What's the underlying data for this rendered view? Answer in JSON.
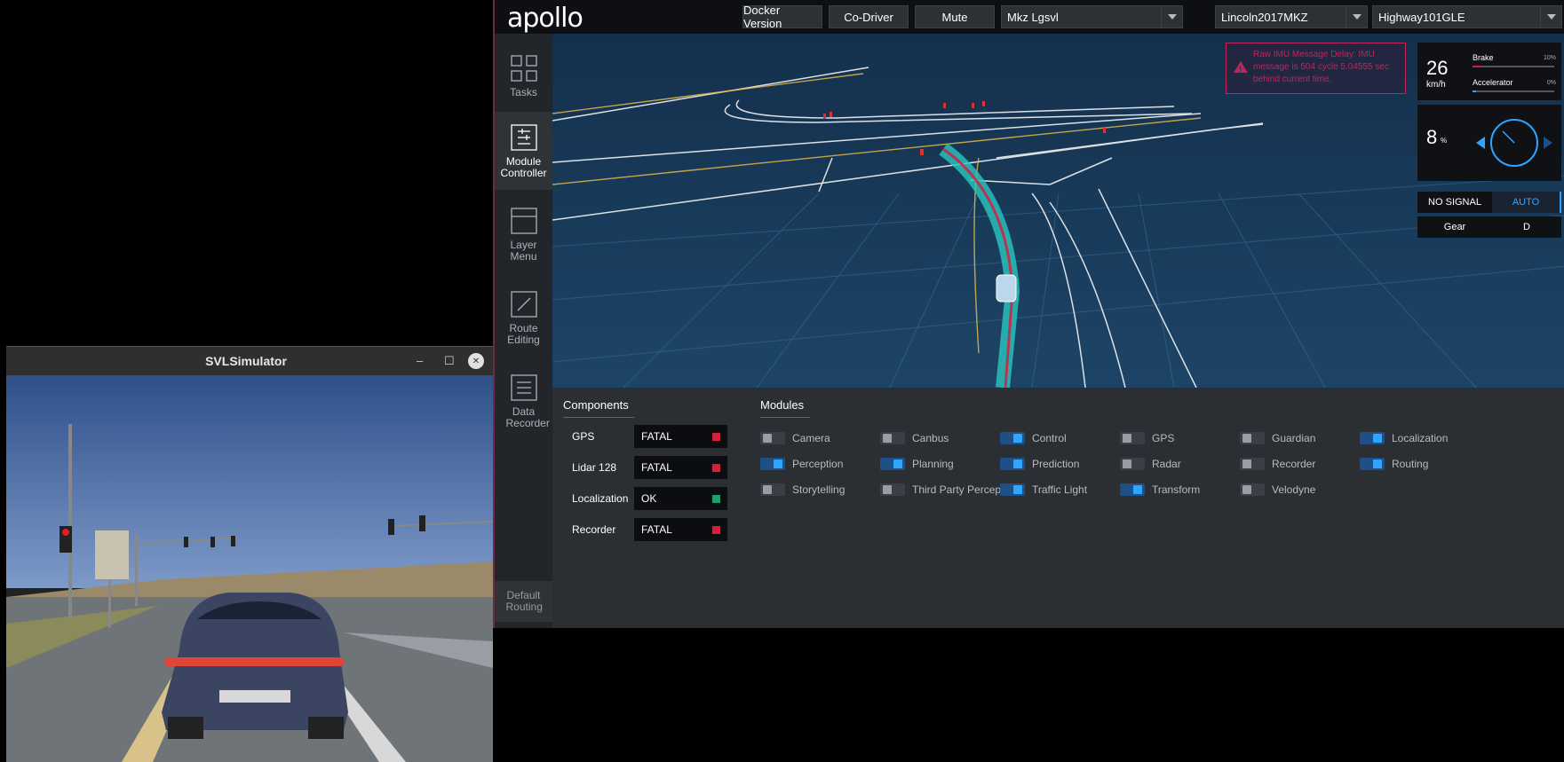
{
  "apollo": {
    "logo": "apollo",
    "header": {
      "docker_version": "Docker Version",
      "co_driver": "Co-Driver",
      "mute": "Mute",
      "mode": "Mkz Lgsvl",
      "vehicle": "Lincoln2017MKZ",
      "map": "Highway101GLE"
    },
    "sidebar": {
      "items": [
        {
          "label": "Tasks",
          "icon": "grid-icon"
        },
        {
          "label": "Module Controller",
          "icon": "sliders-icon"
        },
        {
          "label": "Layer Menu",
          "icon": "layers-icon"
        },
        {
          "label": "Route Editing",
          "icon": "route-icon"
        },
        {
          "label": "Data Recorder",
          "icon": "document-icon"
        }
      ],
      "default_routing": "Default Routing"
    },
    "alert": {
      "text": "Raw IMU Message Delay: IMU message is 504 cycle 5.04555 sec behind current time."
    },
    "dashboard": {
      "speed": "26",
      "speed_unit": "km/h",
      "brake_label": "Brake",
      "brake_value": "10%",
      "brake_fraction": 0.1,
      "accel_label": "Accelerator",
      "accel_value": "0%",
      "accel_fraction": 0.0,
      "steering": "8",
      "steering_unit": "%",
      "signal": "NO SIGNAL",
      "drive_mode": "AUTO",
      "gear_label": "Gear",
      "gear_value": "D"
    },
    "components_title": "Components",
    "components": [
      {
        "name": "GPS",
        "status": "FATAL",
        "color": "#d0213f"
      },
      {
        "name": "Lidar 128",
        "status": "FATAL",
        "color": "#d0213f"
      },
      {
        "name": "Localization",
        "status": "OK",
        "color": "#1e9e6a"
      },
      {
        "name": "Recorder",
        "status": "FATAL",
        "color": "#d0213f"
      }
    ],
    "modules_title": "Modules",
    "modules": [
      {
        "name": "Camera",
        "on": false
      },
      {
        "name": "Canbus",
        "on": false
      },
      {
        "name": "Control",
        "on": true
      },
      {
        "name": "GPS",
        "on": false
      },
      {
        "name": "Guardian",
        "on": false
      },
      {
        "name": "Localization",
        "on": true
      },
      {
        "name": "Perception",
        "on": true
      },
      {
        "name": "Planning",
        "on": true
      },
      {
        "name": "Prediction",
        "on": true
      },
      {
        "name": "Radar",
        "on": false
      },
      {
        "name": "Recorder",
        "on": false
      },
      {
        "name": "Routing",
        "on": true
      },
      {
        "name": "Storytelling",
        "on": false
      },
      {
        "name": "Third Party Perception",
        "on": false
      },
      {
        "name": "Traffic Light",
        "on": true
      },
      {
        "name": "Transform",
        "on": true
      },
      {
        "name": "Velodyne",
        "on": false
      }
    ]
  },
  "svl": {
    "title": "SVLSimulator",
    "minimize": "–",
    "maximize": "☐",
    "close": "✕"
  },
  "colors": {
    "accent": "#30a5ff",
    "fatal": "#d0213f",
    "ok": "#1e9e6a",
    "alert": "#c0245a"
  }
}
